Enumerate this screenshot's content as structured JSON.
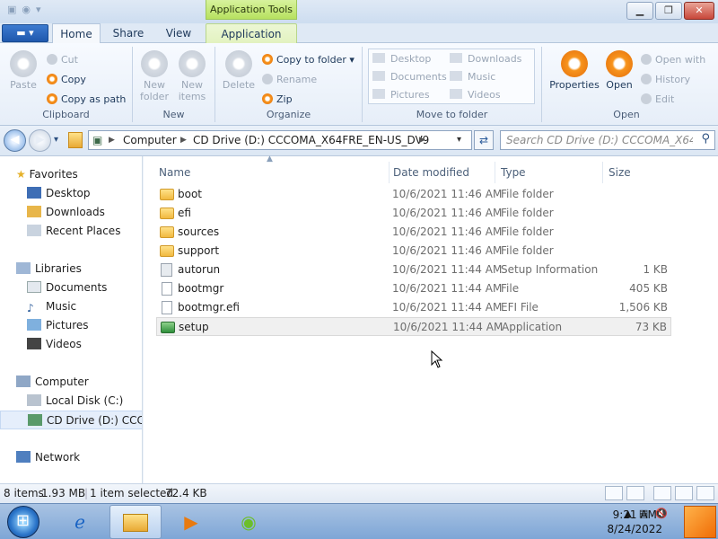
{
  "window": {
    "context_tab_title": "Application Tools",
    "minimize_glyph": "▁",
    "maximize_glyph": "❐",
    "close_glyph": "✕"
  },
  "ribbon": {
    "file_tab_label": "▾",
    "tabs": [
      "Home",
      "Share",
      "View",
      "Application"
    ],
    "clipboard": {
      "label": "Clipboard",
      "paste": "Paste",
      "cut": "Cut",
      "copy": "Copy",
      "copy_as_path": "Copy as path"
    },
    "new": {
      "label": "New",
      "new_folder": "New folder",
      "new_items": "New items"
    },
    "organize": {
      "label": "Organize",
      "delete": "Delete",
      "copy_to_folder": "Copy to folder",
      "rename": "Rename",
      "zip": "Zip"
    },
    "move_to_folder": {
      "label": "Move to folder",
      "items": [
        "Desktop",
        "Downloads",
        "Documents",
        "Music",
        "Pictures",
        "Videos"
      ]
    },
    "open": {
      "label": "Open",
      "properties": "Properties",
      "open": "Open",
      "open_with": "Open with",
      "history": "History",
      "edit": "Edit"
    }
  },
  "address": {
    "segments": [
      "Computer",
      "CD Drive (D:) CCCOMA_X64FRE_EN-US_DV9"
    ],
    "separator": "▶",
    "search_placeholder": "Search CD Drive (D:) CCCOMA_X64FR..."
  },
  "nav": {
    "favorites": "Favorites",
    "favorites_items": [
      "Desktop",
      "Downloads",
      "Recent Places"
    ],
    "libraries": "Libraries",
    "libraries_items": [
      "Documents",
      "Music",
      "Pictures",
      "Videos"
    ],
    "computer": "Computer",
    "computer_items": [
      "Local Disk (C:)",
      "CD Drive (D:) CCCOMA_X64FRE_EN-US_DV9"
    ],
    "network": "Network"
  },
  "columns": {
    "name": "Name",
    "date": "Date modified",
    "type": "Type",
    "size": "Size"
  },
  "files": [
    {
      "name": "boot",
      "date": "10/6/2021 11:46 AM",
      "type": "File folder",
      "size": "",
      "icon": "folder-icon"
    },
    {
      "name": "efi",
      "date": "10/6/2021 11:46 AM",
      "type": "File folder",
      "size": "",
      "icon": "folder-icon"
    },
    {
      "name": "sources",
      "date": "10/6/2021 11:46 AM",
      "type": "File folder",
      "size": "",
      "icon": "folder-icon"
    },
    {
      "name": "support",
      "date": "10/6/2021 11:46 AM",
      "type": "File folder",
      "size": "",
      "icon": "folder-icon"
    },
    {
      "name": "autorun",
      "date": "10/6/2021 11:44 AM",
      "type": "Setup Information",
      "size": "1 KB",
      "icon": "setup-info-icon"
    },
    {
      "name": "bootmgr",
      "date": "10/6/2021 11:44 AM",
      "type": "File",
      "size": "405 KB",
      "icon": "file-icon"
    },
    {
      "name": "bootmgr.efi",
      "date": "10/6/2021 11:44 AM",
      "type": "EFI File",
      "size": "1,506 KB",
      "icon": "file-icon"
    },
    {
      "name": "setup",
      "date": "10/6/2021 11:44 AM",
      "type": "Application",
      "size": "73 KB",
      "icon": "setup-app-icon"
    }
  ],
  "status": {
    "items": "8 items",
    "total": "1.93 MB",
    "selected": "1 item selected",
    "selected_size": "72.4 KB"
  },
  "taskbar": {
    "time": "9:21 AM",
    "date": "8/24/2022"
  }
}
